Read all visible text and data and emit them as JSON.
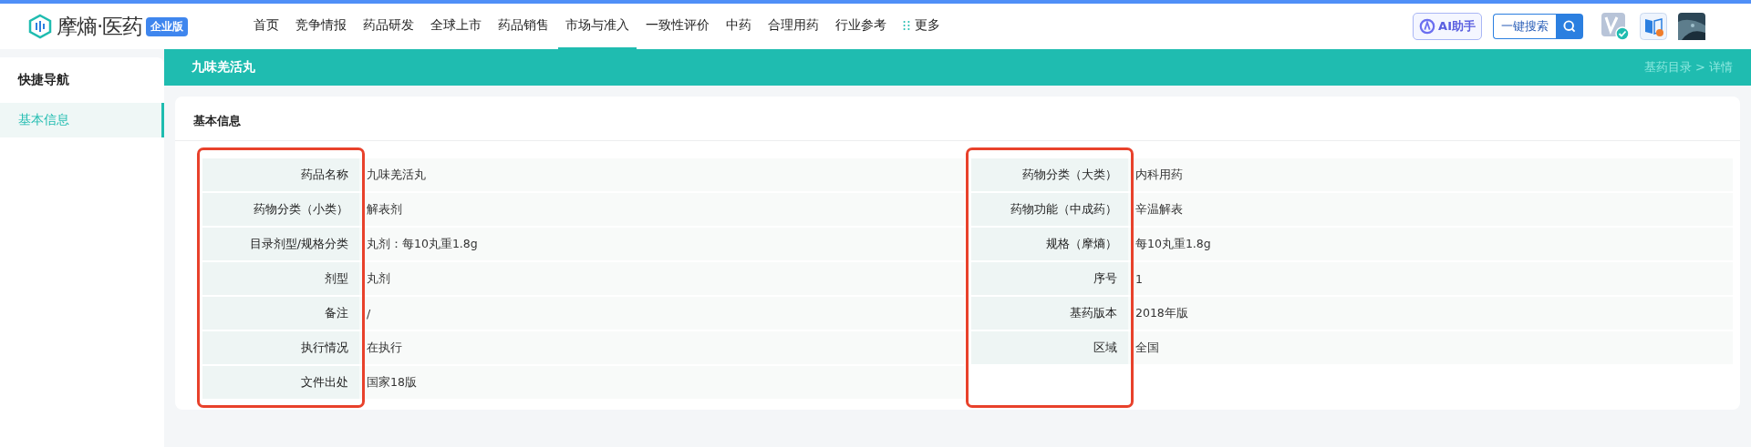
{
  "header": {
    "brand": "摩熵·医药",
    "edition_badge": "企业版",
    "nav": [
      {
        "label": "首页",
        "selected": false
      },
      {
        "label": "竞争情报",
        "selected": false
      },
      {
        "label": "药品研发",
        "selected": false
      },
      {
        "label": "全球上市",
        "selected": false
      },
      {
        "label": "药品销售",
        "selected": false
      },
      {
        "label": "市场与准入",
        "selected": true
      },
      {
        "label": "一致性评价",
        "selected": false
      },
      {
        "label": "中药",
        "selected": false
      },
      {
        "label": "合理用药",
        "selected": false
      },
      {
        "label": "行业参考",
        "selected": false
      },
      {
        "label": "更多",
        "selected": false
      }
    ],
    "ai_button": "AI助手",
    "search_button": "一键搜索"
  },
  "sidebar": {
    "title": "快捷导航",
    "items": [
      {
        "label": "基本信息",
        "selected": true
      }
    ]
  },
  "page_bar": {
    "title": "九味羌活丸",
    "breadcrumb": "基药目录 > 详情"
  },
  "section": {
    "title": "基本信息",
    "tables": [
      {
        "highlighted": true,
        "rows": [
          {
            "label": "药品名称",
            "value": "九味羌活丸"
          },
          {
            "label": "药物分类（小类）",
            "value": "解表剂"
          },
          {
            "label": "目录剂型/规格分类",
            "value": "丸剂：每10丸重1.8g"
          },
          {
            "label": "剂型",
            "value": "丸剂"
          },
          {
            "label": "备注",
            "value": "/"
          },
          {
            "label": "执行情况",
            "value": "在执行"
          },
          {
            "label": "文件出处",
            "value": "国家18版"
          }
        ]
      },
      {
        "highlighted": true,
        "rows": [
          {
            "label": "药物分类（大类）",
            "value": "内科用药"
          },
          {
            "label": "药物功能（中成药）",
            "value": "辛温解表"
          },
          {
            "label": "规格（摩熵）",
            "value": "每10丸重1.8g"
          },
          {
            "label": "序号",
            "value": "1"
          },
          {
            "label": "基药版本",
            "value": "2018年版"
          },
          {
            "label": "区域",
            "value": "全国"
          }
        ]
      }
    ]
  }
}
